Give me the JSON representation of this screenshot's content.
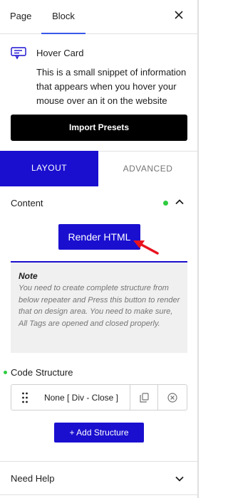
{
  "top_tabs": {
    "page": "Page",
    "block": "Block"
  },
  "block": {
    "title": "Hover Card",
    "description": "This is a small snippet of information that appears when you hover your mouse over an it on the website",
    "icon": "hover-card-icon"
  },
  "import_presets": "Import Presets",
  "mode_tabs": {
    "layout": "LAYOUT",
    "advanced": "ADVANCED",
    "active": "layout"
  },
  "content": {
    "title": "Content",
    "render_button": "Render HTML",
    "note_title": "Note",
    "note_text": "You need to create complete structure from below repeater and Press this button to render that on design area. You need to make sure, All Tags are opened and closed properly.",
    "code_structure_label": "Code Structure",
    "repeater_items": [
      {
        "label": "None [ Div - Close ]"
      }
    ],
    "add_structure": "+ Add Structure"
  },
  "help": {
    "title": "Need Help"
  },
  "colors": {
    "accent": "#1a0fcf",
    "tab_underline": "#3858e9",
    "status_dot": "#2ecc40",
    "annotation_arrow": "#e8131f"
  }
}
